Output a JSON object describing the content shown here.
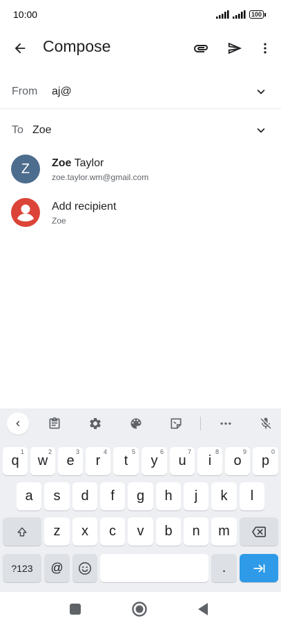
{
  "status_bar": {
    "time": "10:00",
    "battery": "100"
  },
  "app_bar": {
    "title": "Compose"
  },
  "from": {
    "label": "From",
    "value": "aj@"
  },
  "to": {
    "label": "To",
    "value": "Zoe"
  },
  "suggestions": [
    {
      "avatar_letter": "Z",
      "name_bold": "Zoe",
      "name_rest": " Taylor",
      "subtitle": "zoe.taylor.wm@gmail.com",
      "avatar_color": "#4d6d8e"
    },
    {
      "name": "Add recipient",
      "subtitle": "Zoe",
      "avatar_color": "#db4437"
    }
  ],
  "keyboard": {
    "toolbar_icons": [
      "chevron-left-icon",
      "clipboard-icon",
      "gear-icon",
      "palette-icon",
      "sticker-icon",
      "more-horizontal-icon",
      "mic-off-icon"
    ],
    "row1": [
      {
        "key": "q",
        "hint": "1"
      },
      {
        "key": "w",
        "hint": "2"
      },
      {
        "key": "e",
        "hint": "3"
      },
      {
        "key": "r",
        "hint": "4"
      },
      {
        "key": "t",
        "hint": "5"
      },
      {
        "key": "y",
        "hint": "6"
      },
      {
        "key": "u",
        "hint": "7"
      },
      {
        "key": "i",
        "hint": "8"
      },
      {
        "key": "o",
        "hint": "9"
      },
      {
        "key": "p",
        "hint": "0"
      }
    ],
    "row2": [
      "a",
      "s",
      "d",
      "f",
      "g",
      "h",
      "j",
      "k",
      "l"
    ],
    "row3": [
      "z",
      "x",
      "c",
      "v",
      "b",
      "n",
      "m"
    ],
    "symbols_label": "?123",
    "at_label": "@",
    "period_label": ".",
    "accent_color": "#2e9ae8"
  }
}
